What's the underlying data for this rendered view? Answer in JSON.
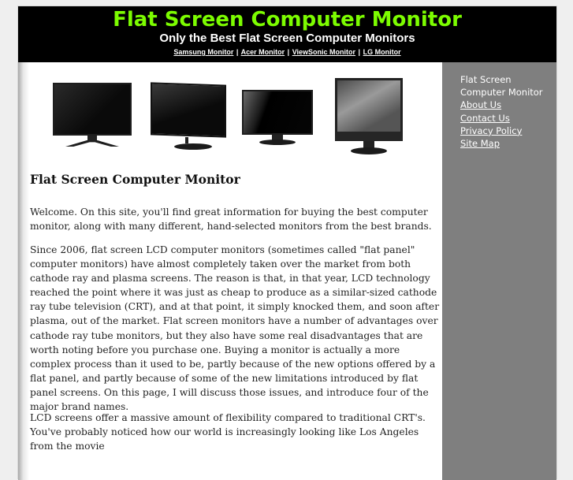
{
  "header": {
    "title": "Flat Screen Computer Monitor",
    "tagline": "Only the Best Flat Screen Computer Monitors",
    "brand_links": [
      {
        "label": "Samsung Monitor"
      },
      {
        "label": "Acer Monitor"
      },
      {
        "label": "ViewSonic Monitor"
      },
      {
        "label": "LG Monitor"
      }
    ],
    "separator": "|"
  },
  "sidebar": {
    "items": [
      {
        "label": "Flat Screen Computer Monitor",
        "link": false
      },
      {
        "label": "About Us",
        "link": true
      },
      {
        "label": "Contact Us",
        "link": true
      },
      {
        "label": "Privacy Policy",
        "link": true
      },
      {
        "label": "Site Map",
        "link": true
      }
    ]
  },
  "images": [
    {
      "name": "acer-monitor-image",
      "desc": "widescreen monitor with X-shaped stand"
    },
    {
      "name": "samsung-monitor-image",
      "desc": "glossy monitor with round base"
    },
    {
      "name": "lg-monitor-image",
      "desc": "glossy widescreen monitor"
    },
    {
      "name": "viewsonic-monitor-image",
      "desc": "square 4:3 monitor"
    }
  ],
  "content": {
    "heading": "Flat Screen Computer Monitor",
    "paragraphs": [
      "Welcome. On this site, you'll find great information for buying the best computer monitor, along with many different, hand-selected monitors from the best brands.",
      "Since 2006, flat screen LCD computer monitors (sometimes called \"flat panel\" computer monitors) have almost completely taken over the market from both cathode ray and plasma screens. The reason is that, in that year, LCD technology reached the point where it was just as cheap to produce as a similar-sized cathode ray tube television (CRT), and at that point, it simply knocked them, and soon after plasma, out of the market. Flat screen monitors have a number of advantages over cathode ray tube monitors, but they also have some real disadvantages that are worth noting before you purchase one. Buying a monitor is actually a more complex process than it used to be, partly because of the new options offered by a flat panel, and partly because of some of the new limitations introduced by flat panel screens. On this page, I will discuss those issues, and introduce four of the major brand names.",
      "LCD screens offer a massive amount of flexibility compared to traditional CRT's. You've probably noticed how our world is increasingly looking like Los Angeles from the movie"
    ]
  },
  "colors": {
    "title_green": "#7cfc00",
    "header_bg": "#000000",
    "sidebar_bg": "#7f7f7f",
    "page_bg": "#efefef"
  }
}
